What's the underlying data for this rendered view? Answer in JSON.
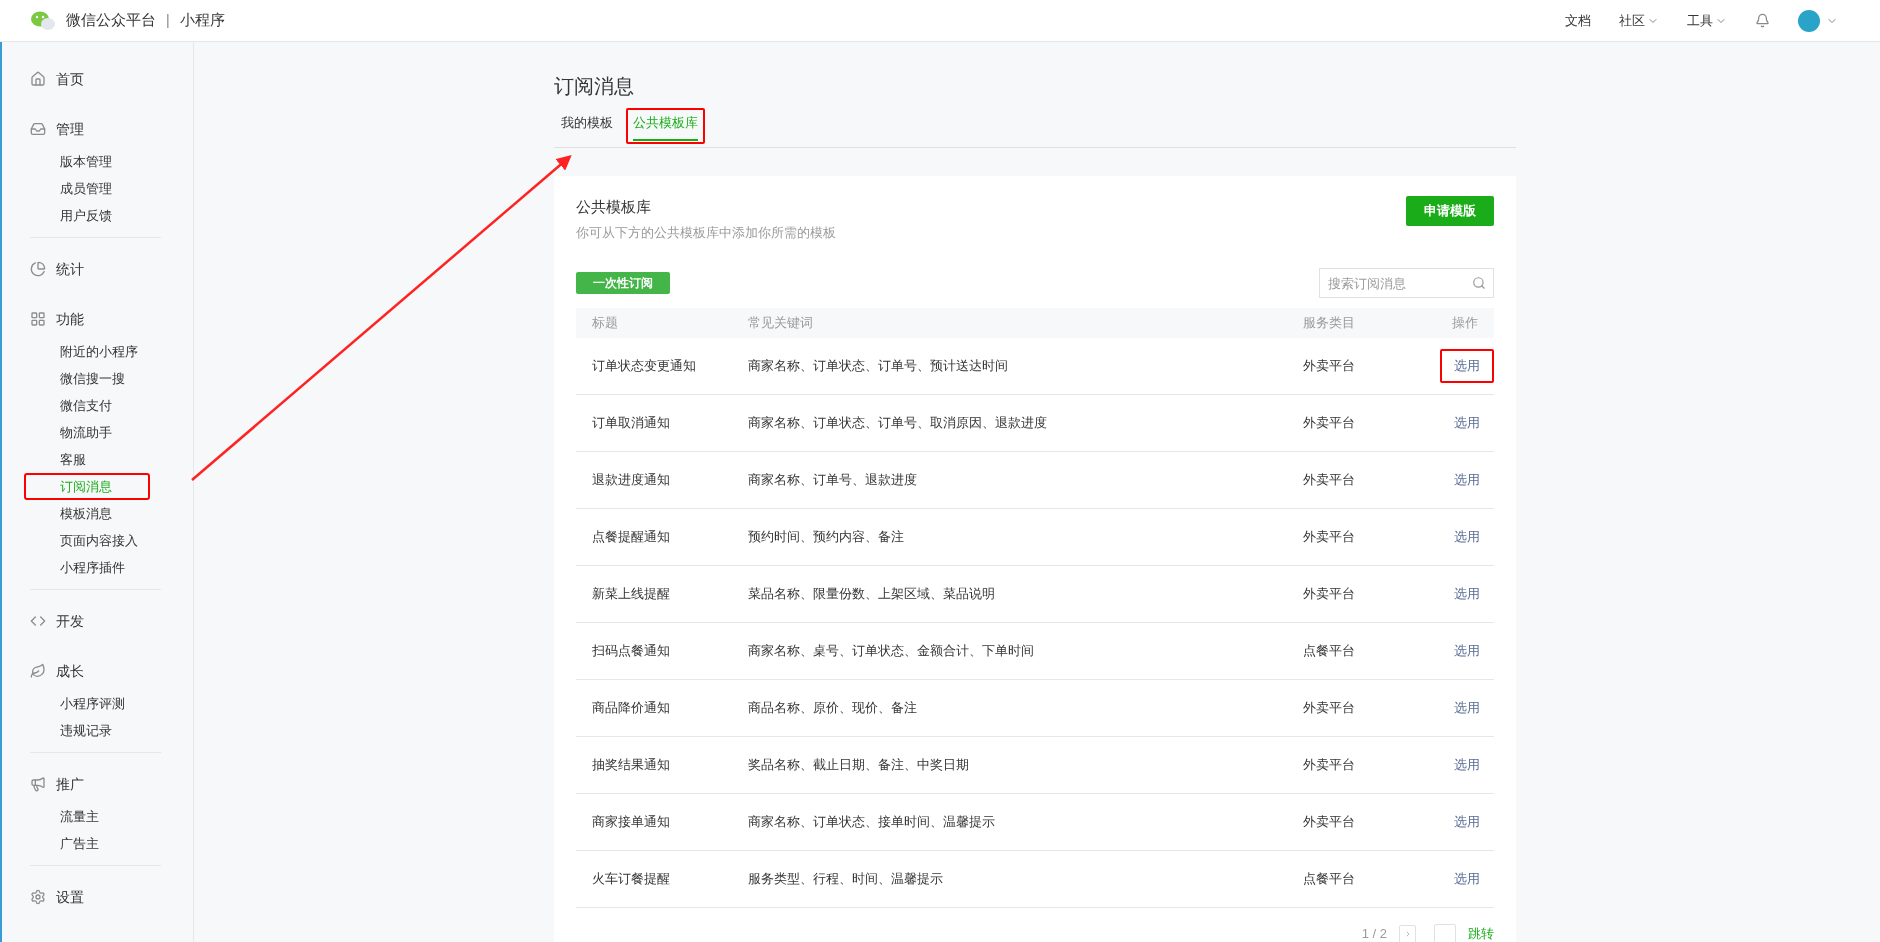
{
  "topbar": {
    "brand": "微信公众平台",
    "separator": "|",
    "product": "小程序",
    "links": [
      {
        "label": "文档",
        "dropdown": false
      },
      {
        "label": "社区",
        "dropdown": true
      },
      {
        "label": "工具",
        "dropdown": true
      }
    ]
  },
  "sidebar": [
    {
      "label": "首页"
    },
    {
      "label": "管理",
      "children": [
        {
          "label": "版本管理",
          "selected": false,
          "annotated": false
        },
        {
          "label": "成员管理",
          "selected": false,
          "annotated": false
        },
        {
          "label": "用户反馈",
          "selected": false,
          "annotated": false
        }
      ]
    },
    {
      "label": "统计"
    },
    {
      "label": "功能",
      "children": [
        {
          "label": "附近的小程序",
          "selected": false,
          "annotated": false
        },
        {
          "label": "微信搜一搜",
          "selected": false,
          "annotated": false
        },
        {
          "label": "微信支付",
          "selected": false,
          "annotated": false
        },
        {
          "label": "物流助手",
          "selected": false,
          "annotated": false
        },
        {
          "label": "客服",
          "selected": false,
          "annotated": false
        },
        {
          "label": "订阅消息",
          "selected": true,
          "annotated": true
        },
        {
          "label": "模板消息",
          "selected": false,
          "annotated": false
        },
        {
          "label": "页面内容接入",
          "selected": false,
          "annotated": false
        },
        {
          "label": "小程序插件",
          "selected": false,
          "annotated": false
        }
      ]
    },
    {
      "label": "开发"
    },
    {
      "label": "成长",
      "children": [
        {
          "label": "小程序评测",
          "selected": false,
          "annotated": false
        },
        {
          "label": "违规记录",
          "selected": false,
          "annotated": false
        }
      ]
    },
    {
      "label": "推广",
      "children": [
        {
          "label": "流量主",
          "selected": false,
          "annotated": false
        },
        {
          "label": "广告主",
          "selected": false,
          "annotated": false
        }
      ]
    },
    {
      "label": "设置"
    }
  ],
  "page_title": "订阅消息",
  "tabs": [
    {
      "label": "我的模板",
      "selected": false,
      "annotated": false
    },
    {
      "label": "公共模板库",
      "selected": true,
      "annotated": true
    }
  ],
  "card": {
    "title": "公共模板库",
    "subtitle": "你可从下方的公共模板库中添加你所需的模板",
    "apply_button": "申请模版",
    "filter_button": "一次性订阅",
    "search": {
      "placeholder": "搜索订阅消息"
    }
  },
  "table": {
    "columns": [
      "标题",
      "常见关键词",
      "服务类目",
      "操作"
    ],
    "rows": [
      {
        "title": "订单状态变更通知",
        "keywords": "商家名称、订单状态、订单号、预计送达时间",
        "category": "外卖平台",
        "action": "选用",
        "annotated": true
      },
      {
        "title": "订单取消通知",
        "keywords": "商家名称、订单状态、订单号、取消原因、退款进度",
        "category": "外卖平台",
        "action": "选用",
        "annotated": false
      },
      {
        "title": "退款进度通知",
        "keywords": "商家名称、订单号、退款进度",
        "category": "外卖平台",
        "action": "选用",
        "annotated": false
      },
      {
        "title": "点餐提醒通知",
        "keywords": "预约时间、预约内容、备注",
        "category": "外卖平台",
        "action": "选用",
        "annotated": false
      },
      {
        "title": "新菜上线提醒",
        "keywords": "菜品名称、限量份数、上架区域、菜品说明",
        "category": "外卖平台",
        "action": "选用",
        "annotated": false
      },
      {
        "title": "扫码点餐通知",
        "keywords": "商家名称、桌号、订单状态、金额合计、下单时间",
        "category": "点餐平台",
        "action": "选用",
        "annotated": false
      },
      {
        "title": "商品降价通知",
        "keywords": "商品名称、原价、现价、备注",
        "category": "外卖平台",
        "action": "选用",
        "annotated": false
      },
      {
        "title": "抽奖结果通知",
        "keywords": "奖品名称、截止日期、备注、中奖日期",
        "category": "外卖平台",
        "action": "选用",
        "annotated": false
      },
      {
        "title": "商家接单通知",
        "keywords": "商家名称、订单状态、接单时间、温馨提示",
        "category": "外卖平台",
        "action": "选用",
        "annotated": false
      },
      {
        "title": "火车订餐提醒",
        "keywords": "服务类型、行程、时间、温馨提示",
        "category": "点餐平台",
        "action": "选用",
        "annotated": false
      }
    ]
  },
  "pagination": {
    "page": "1 / 2",
    "jump": "跳转"
  },
  "annotation_arrow": true
}
